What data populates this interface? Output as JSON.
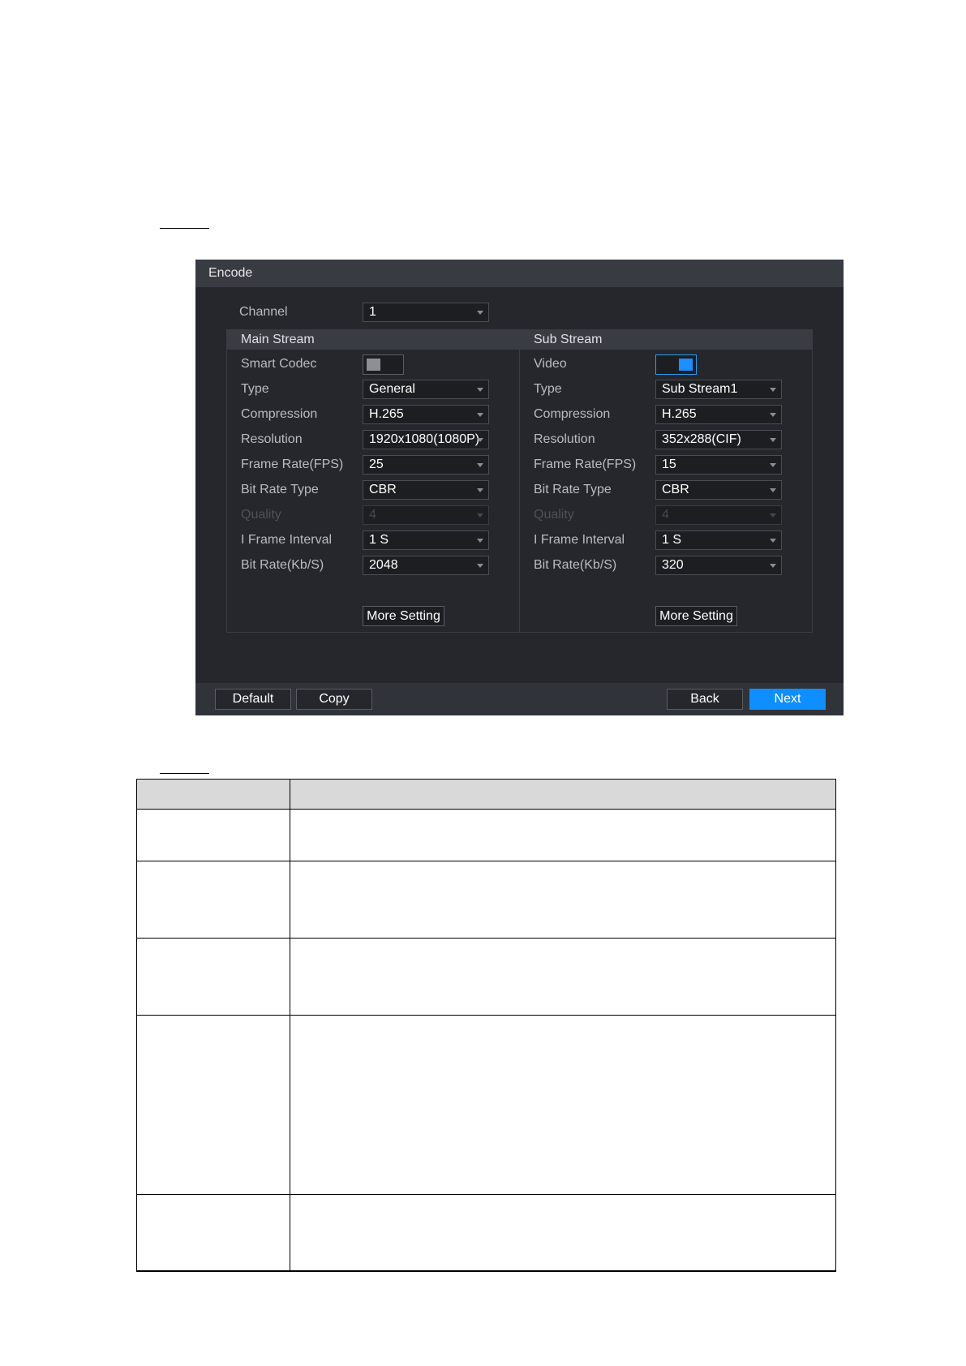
{
  "window": {
    "title": "Encode"
  },
  "channel": {
    "label": "Channel",
    "value": "1"
  },
  "main_stream": {
    "title": "Main Stream",
    "smart_codec": {
      "label": "Smart Codec",
      "state": "off"
    },
    "type": {
      "label": "Type",
      "value": "General"
    },
    "compression": {
      "label": "Compression",
      "value": "H.265"
    },
    "resolution": {
      "label": "Resolution",
      "value": "1920x1080(1080P)"
    },
    "frame_rate": {
      "label": "Frame Rate(FPS)",
      "value": "25"
    },
    "bit_rate_type": {
      "label": "Bit Rate Type",
      "value": "CBR"
    },
    "quality": {
      "label": "Quality",
      "value": "4",
      "disabled": true
    },
    "i_frame_interval": {
      "label": "I Frame Interval",
      "value": "1 S"
    },
    "bit_rate": {
      "label": "Bit Rate(Kb/S)",
      "value": "2048"
    },
    "more_setting": "More Setting"
  },
  "sub_stream": {
    "title": "Sub Stream",
    "video": {
      "label": "Video",
      "state": "on"
    },
    "type": {
      "label": "Type",
      "value": "Sub Stream1"
    },
    "compression": {
      "label": "Compression",
      "value": "H.265"
    },
    "resolution": {
      "label": "Resolution",
      "value": "352x288(CIF)"
    },
    "frame_rate": {
      "label": "Frame Rate(FPS)",
      "value": "15"
    },
    "bit_rate_type": {
      "label": "Bit Rate Type",
      "value": "CBR"
    },
    "quality": {
      "label": "Quality",
      "value": "4",
      "disabled": true
    },
    "i_frame_interval": {
      "label": "I Frame Interval",
      "value": "1 S"
    },
    "bit_rate": {
      "label": "Bit Rate(Kb/S)",
      "value": "320"
    },
    "more_setting": "More Setting"
  },
  "footer": {
    "default": "Default",
    "copy": "Copy",
    "back": "Back",
    "next": "Next"
  },
  "colors": {
    "accent": "#0f8fff",
    "window_bg": "#25272c",
    "header_bg": "#393b42"
  }
}
